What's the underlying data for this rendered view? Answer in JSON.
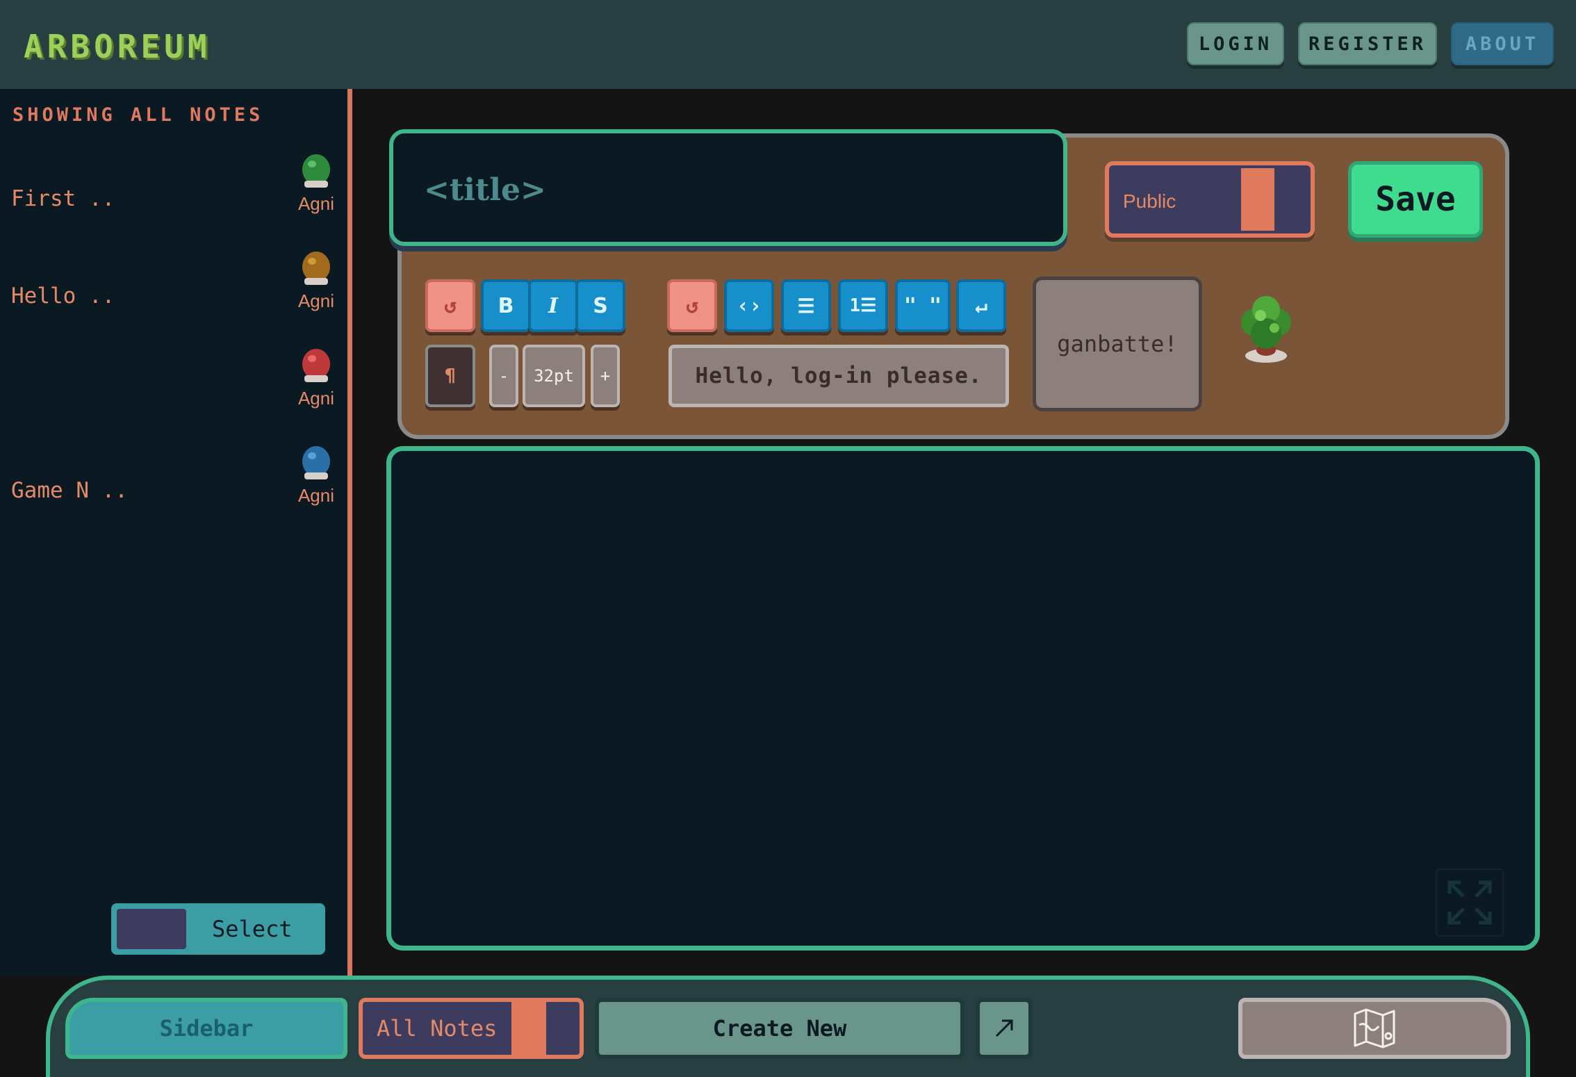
{
  "header": {
    "logo": "ARBOREUM",
    "nav": {
      "login": "LOGIN",
      "register": "REGISTER",
      "about": "ABOUT"
    }
  },
  "sidebar": {
    "title": "SHOWING ALL NOTES",
    "notes": [
      {
        "name": "First ..",
        "owner": "Agni",
        "avatar_color": "#2e8b3e"
      },
      {
        "name": "Hello ..",
        "owner": "Agni",
        "avatar_color": "#a06b1e"
      },
      {
        "name": "",
        "owner": "Agni",
        "avatar_color": "#c0393a"
      },
      {
        "name": "Game N ..",
        "owner": "Agni",
        "avatar_color": "#2a6fa8"
      }
    ],
    "select_label": "Select"
  },
  "editor": {
    "title_placeholder": "<title>",
    "visibility": "Public",
    "save_label": "Save",
    "toolbar": {
      "font_size": "32pt",
      "decrease": "-",
      "increase": "+",
      "status_text": "Hello, log-in please.",
      "motivation": "ganbatte!"
    }
  },
  "footer": {
    "sidebar_label": "Sidebar",
    "all_notes_label": "All Notes",
    "create_label": "Create New"
  },
  "colors": {
    "accent_green": "#3fb58c",
    "accent_orange": "#e07a5f",
    "panel_brown": "#7a5538",
    "dark_bg": "#0b1a22"
  }
}
